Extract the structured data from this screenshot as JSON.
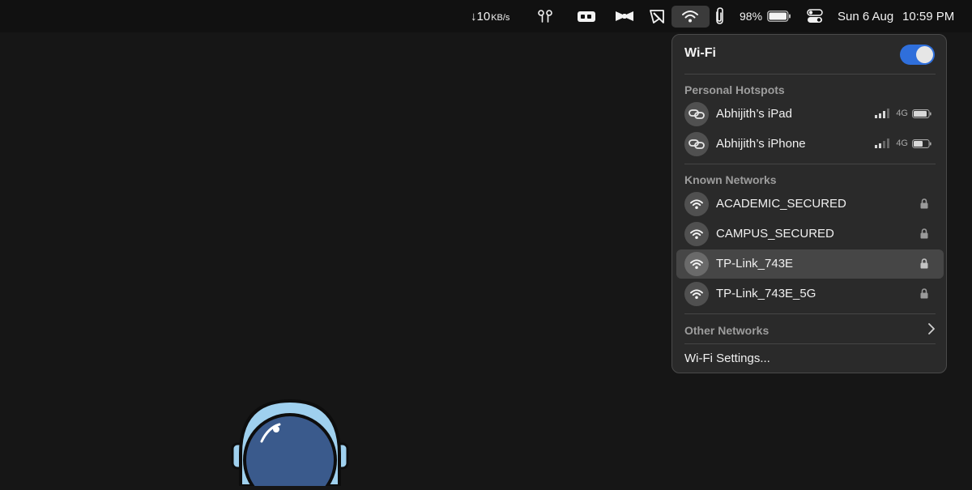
{
  "menubar": {
    "net_speed_value": "↓10",
    "net_speed_unit": "KB/s",
    "battery_percent": "98%",
    "date": "Sun 6 Aug",
    "time": "10:59 PM",
    "icons": [
      "network-speed-icon",
      "airpods-icon",
      "tv-remote-icon",
      "bowtie-icon",
      "pointer-app-icon",
      "wifi-icon",
      "paperclip-icon",
      "battery-icon",
      "control-center-icon"
    ]
  },
  "wifi_menu": {
    "title": "Wi-Fi",
    "enabled": true,
    "accent_color": "#2f6fdb",
    "hotspots_label": "Personal Hotspots",
    "hotspots": [
      {
        "name": "Abhijith’s iPad",
        "network": "4G",
        "signal_bars": 3,
        "battery_level": 0.85
      },
      {
        "name": "Abhijith’s iPhone",
        "network": "4G",
        "signal_bars": 2,
        "battery_level": 0.6
      }
    ],
    "known_label": "Known Networks",
    "known": [
      {
        "name": "ACADEMIC_SECURED",
        "secured": true,
        "highlighted": false
      },
      {
        "name": "CAMPUS_SECURED",
        "secured": true,
        "highlighted": false
      },
      {
        "name": "TP-Link_743E",
        "secured": true,
        "highlighted": true
      },
      {
        "name": "TP-Link_743E_5G",
        "secured": true,
        "highlighted": false
      }
    ],
    "other_label": "Other Networks",
    "settings_label": "Wi-Fi Settings..."
  }
}
